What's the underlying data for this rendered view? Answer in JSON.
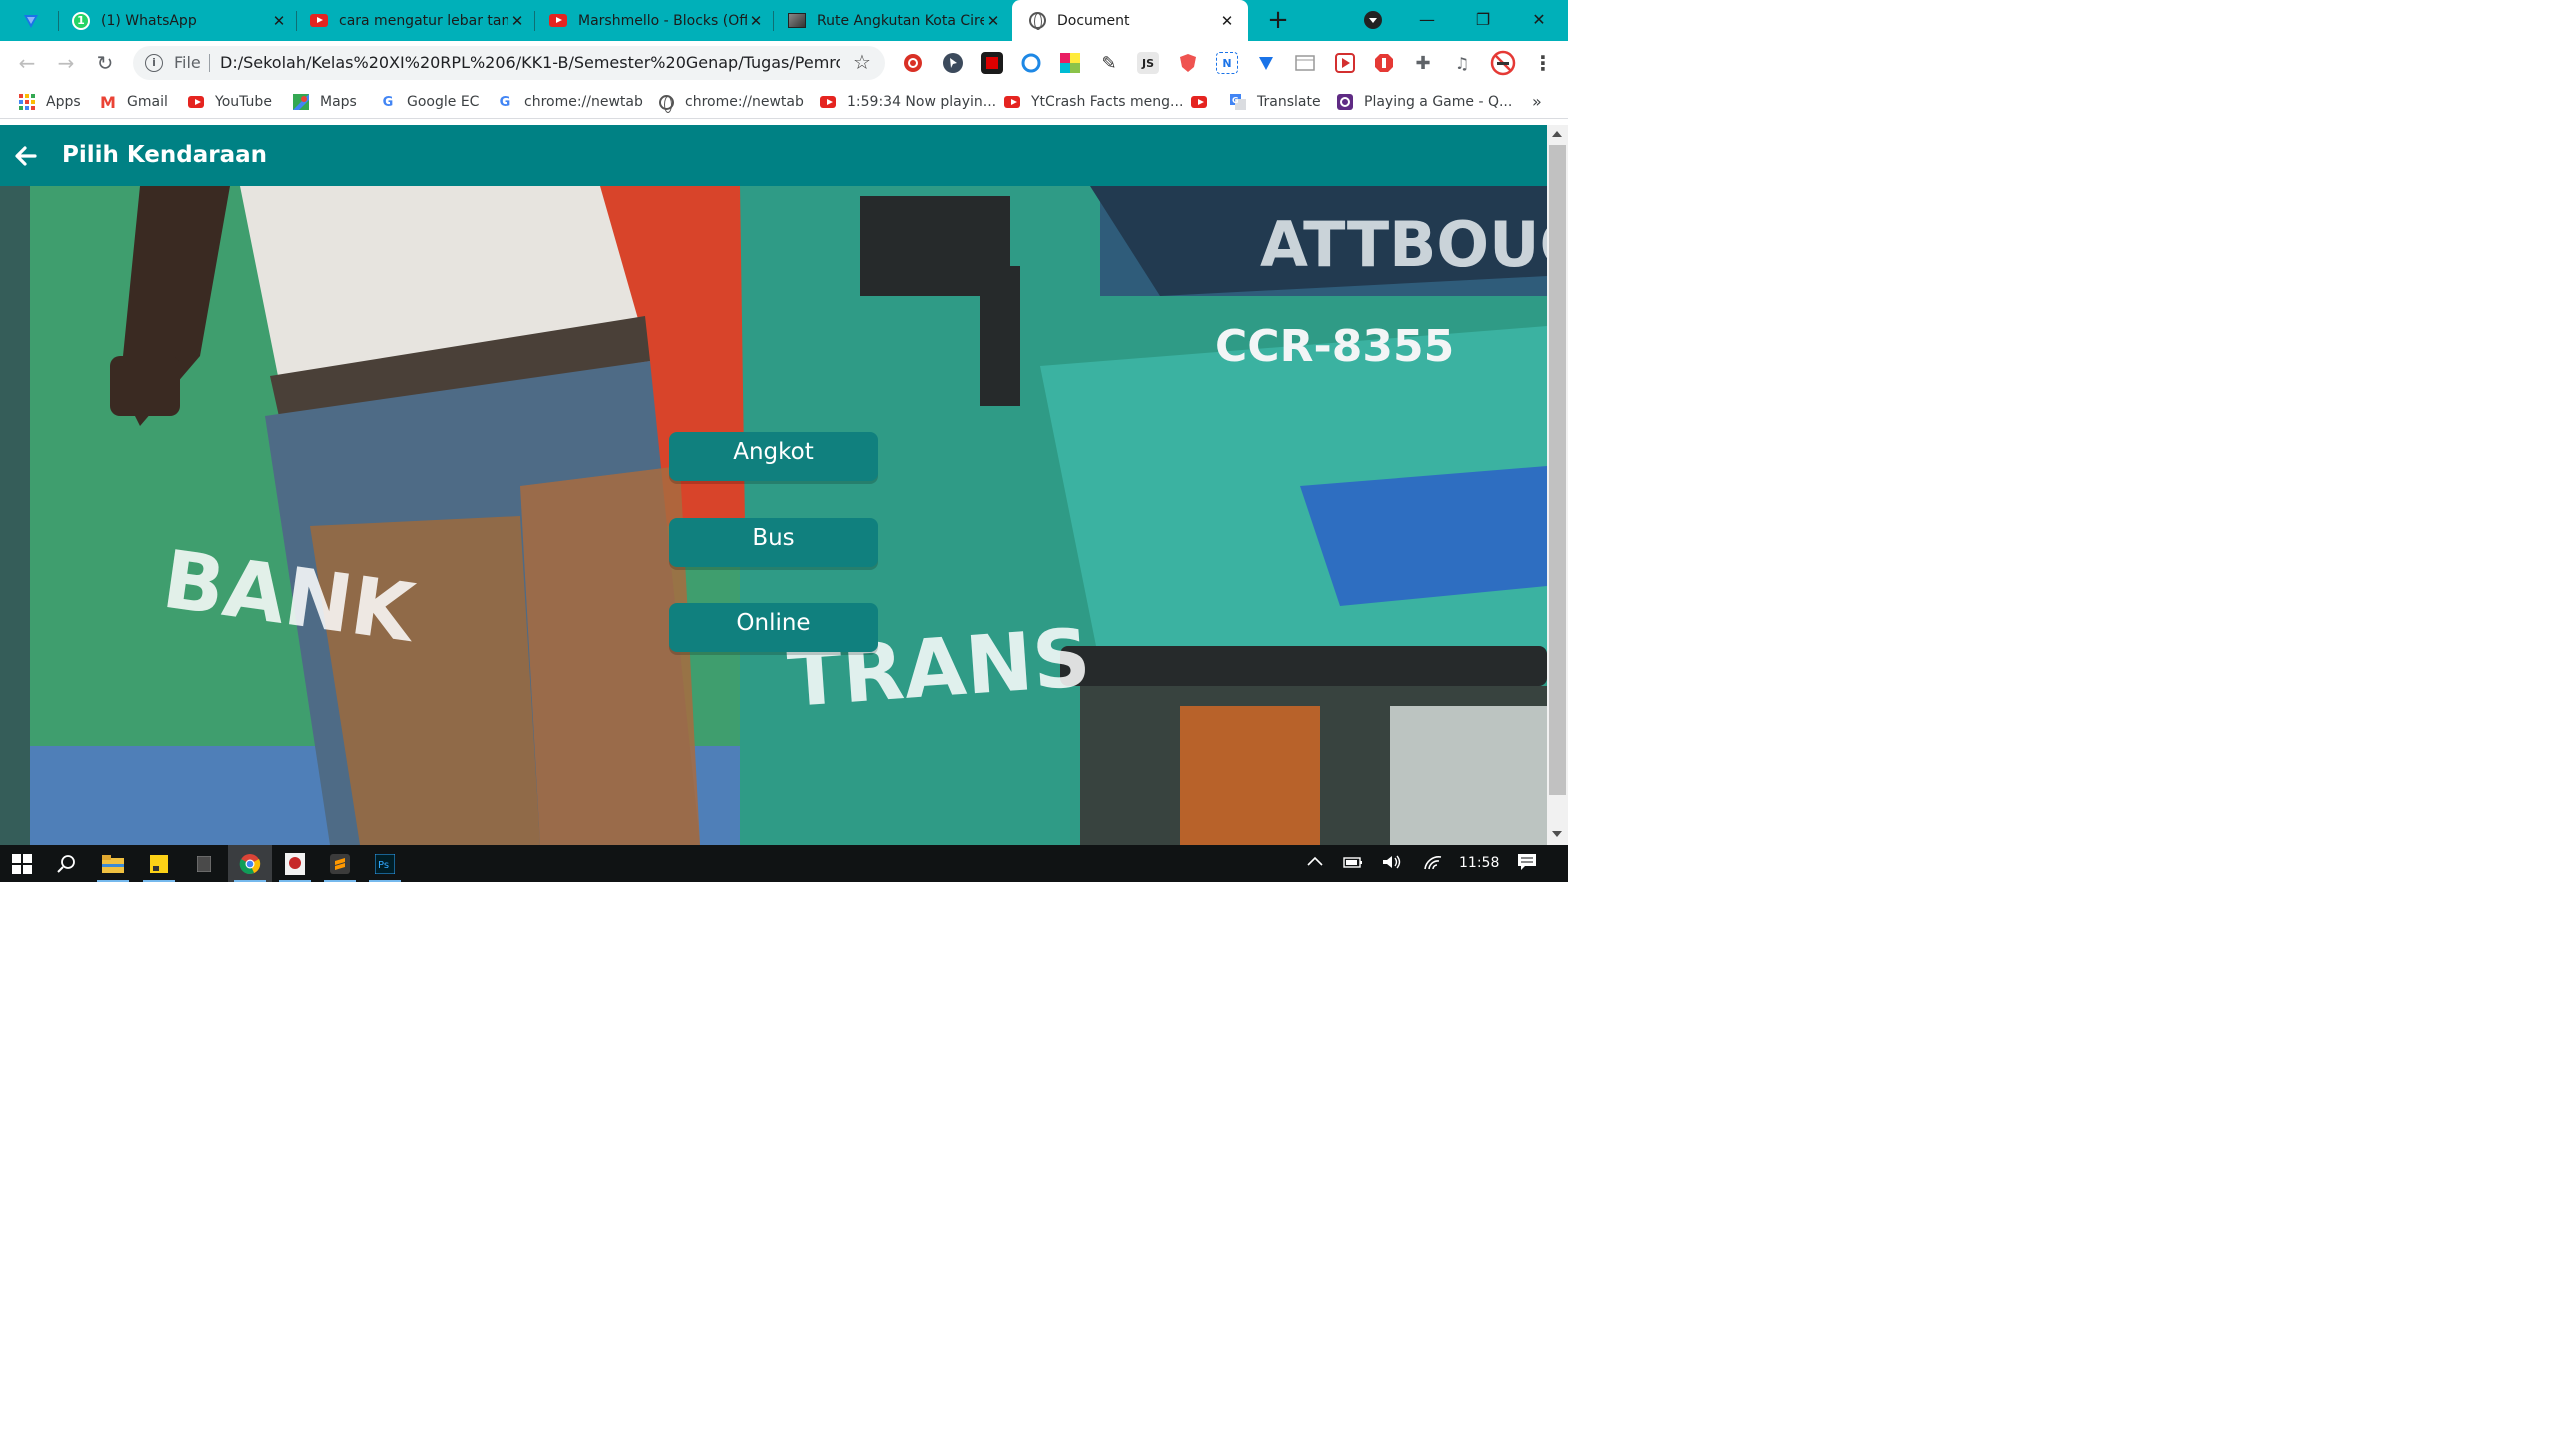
{
  "browser": {
    "tabs": [
      {
        "title": "",
        "favicon": "vpn-heart-icon"
      },
      {
        "title": "(1) WhatsApp",
        "favicon": "whatsapp-icon"
      },
      {
        "title": "cara mengatur lebar tam",
        "favicon": "youtube-icon"
      },
      {
        "title": "Marshmello - Blocks (Off",
        "favicon": "youtube-icon"
      },
      {
        "title": "Rute Angkutan Kota Cire",
        "favicon": "photo-icon"
      },
      {
        "title": "Document",
        "favicon": "globe-icon",
        "active": true
      }
    ],
    "new_tab_label": "+",
    "url_scheme_label": "File",
    "url": "D:/Sekolah/Kelas%20XI%20RPL%206/KK1-B/Semester%20Genap/Tugas/Pemrog...",
    "bookmarks": [
      {
        "label": "Apps",
        "icon": "apps-grid-icon"
      },
      {
        "label": "Gmail",
        "icon": "gmail-icon"
      },
      {
        "label": "YouTube",
        "icon": "youtube-icon"
      },
      {
        "label": "Maps",
        "icon": "maps-icon"
      },
      {
        "label": "Google EC",
        "icon": "google-icon"
      },
      {
        "label": "chrome://newtab",
        "icon": "google-icon"
      },
      {
        "label": "chrome://newtab",
        "icon": "globe-icon"
      },
      {
        "label": "1:59:34 Now playin...",
        "icon": "youtube-icon"
      },
      {
        "label": "YtCrash Facts meng...",
        "icon": "youtube-icon"
      },
      {
        "label": "",
        "icon": "youtube-icon"
      },
      {
        "label": "Translate",
        "icon": "translate-icon"
      },
      {
        "label": "Playing a Game - Q...",
        "icon": "quizizz-icon"
      }
    ],
    "bookmarks_overflow": "»"
  },
  "page": {
    "title": "Pilih Kendaraan",
    "menu": [
      {
        "label": "Angkot"
      },
      {
        "label": "Bus"
      },
      {
        "label": "Online"
      }
    ],
    "background_text": {
      "plate": "CCR-8355",
      "top": "ATTBOUG",
      "left": "BANK",
      "middle": "TRANS"
    },
    "colors": {
      "appbar": "#008184",
      "button": "#10807e",
      "tabstrip": "#00b0b9"
    }
  },
  "taskbar": {
    "time": "11:58"
  }
}
